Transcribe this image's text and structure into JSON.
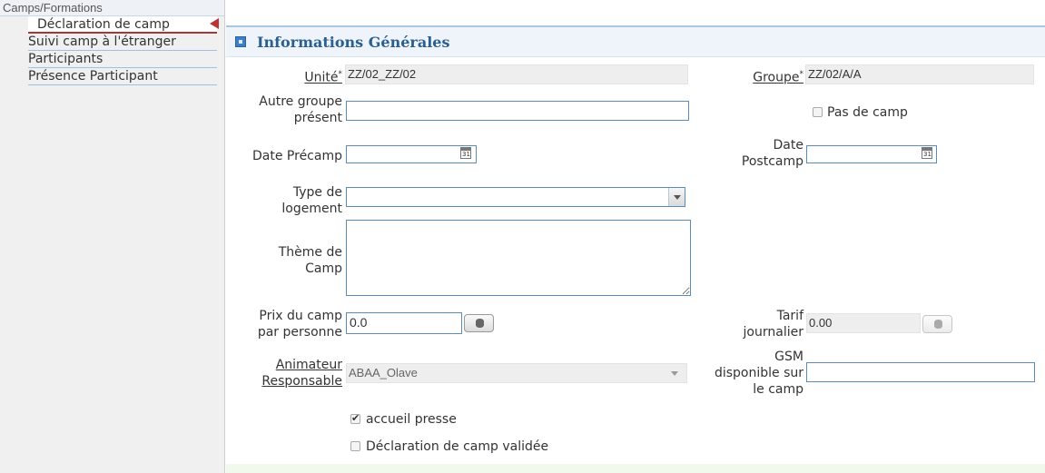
{
  "sidebar": {
    "section_title": "Camps/Formations",
    "items": [
      {
        "label": "Déclaration de camp",
        "active": true
      },
      {
        "label": "Suivi camp à l'étranger"
      },
      {
        "label": "Participants"
      },
      {
        "label": "Présence Participant"
      }
    ]
  },
  "panel": {
    "title": "Informations Générales",
    "fields": {
      "unite": {
        "label": "Unité",
        "required_mark": "*",
        "value": "ZZ/02_ZZ/02"
      },
      "groupe": {
        "label": "Groupe",
        "required_mark": "*",
        "value": "ZZ/02/A/A"
      },
      "autre_groupe": {
        "label_line1": "Autre groupe",
        "label_line2": "présent",
        "value": ""
      },
      "pas_de_camp": {
        "label": "Pas de camp",
        "checked": false
      },
      "date_precamp": {
        "label": "Date Précamp",
        "value": ""
      },
      "date_postcamp": {
        "label_line1": "Date",
        "label_line2": "Postcamp",
        "value": ""
      },
      "type_logement": {
        "label_line1": "Type de",
        "label_line2": "logement",
        "value": ""
      },
      "theme_camp": {
        "label_line1": "Thème de",
        "label_line2": "Camp",
        "value": ""
      },
      "prix_camp": {
        "label_line1": "Prix du camp",
        "label_line2": "par personne",
        "value": "0.0"
      },
      "tarif_journalier": {
        "label_line1": "Tarif",
        "label_line2": "journalier",
        "value": "0.00"
      },
      "animateur": {
        "label_line1": "Animateur",
        "label_line2": "Responsable",
        "value": "ABAA_Olave"
      },
      "gsm": {
        "label_line1": "GSM",
        "label_line2": "disponible sur",
        "label_line3": "le camp",
        "value": ""
      },
      "accueil_presse": {
        "label": "accueil presse",
        "checked": true
      },
      "declaration_validee": {
        "label": "Déclaration de camp validée",
        "checked": false
      }
    }
  },
  "icons": {
    "panel_header": "collapse-icon",
    "calendar": "calendar-icon",
    "calculator": "database-icon",
    "dropdown": "chevron-down-icon",
    "active_marker": "arrow-left-icon"
  },
  "colors": {
    "header_title": "#2a5f8f",
    "active_marker": "#b93535",
    "input_border": "#5b8bb8"
  }
}
